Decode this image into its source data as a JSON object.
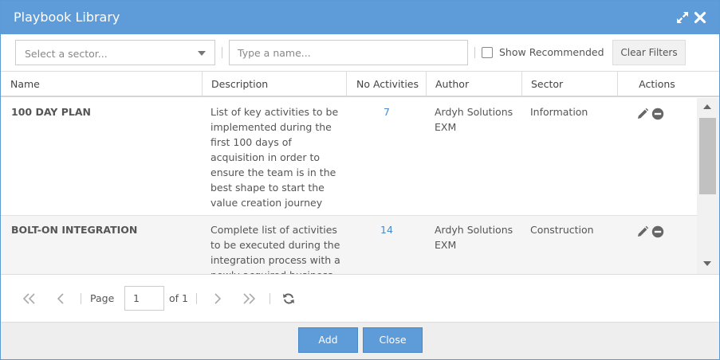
{
  "dialog": {
    "title": "Playbook Library"
  },
  "colors": {
    "accent": "#5d9cd8",
    "link": "#4a8ac9",
    "header_bg": "#5d9cd8",
    "footer_bg": "#eeeeee"
  },
  "icons": {
    "maximize": "expand-arrows-icon",
    "close": "close-x-icon",
    "edit": "pencil-icon",
    "remove": "minus-circle-icon",
    "refresh": "refresh-icon"
  },
  "filters": {
    "sector_placeholder": "Select a sector...",
    "name_placeholder": "Type a name...",
    "show_recommended_label": "Show Recommended",
    "show_recommended_checked": false,
    "clear_label": "Clear Filters"
  },
  "grid": {
    "columns": [
      "Name",
      "Description",
      "No Activities",
      "Author",
      "Sector",
      "Actions"
    ],
    "rows": [
      {
        "name": "100 DAY PLAN",
        "description": "List of key activities to be implemented during the first 100 days of acquisition in order to ensure the team is in the best shape to start the value creation journey",
        "activities": "7",
        "author": "Ardyh Solutions EXM",
        "sector": "Information"
      },
      {
        "name": "BOLT-ON INTEGRATION",
        "description": "Complete list of activities to be executed during the integration process with a newly acquired business",
        "activities": "14",
        "author": "Ardyh Solutions EXM",
        "sector": "Construction"
      }
    ]
  },
  "pager": {
    "page_label": "Page",
    "page_value": "1",
    "of_label": "of 1"
  },
  "footer": {
    "add_label": "Add",
    "close_label": "Close"
  }
}
